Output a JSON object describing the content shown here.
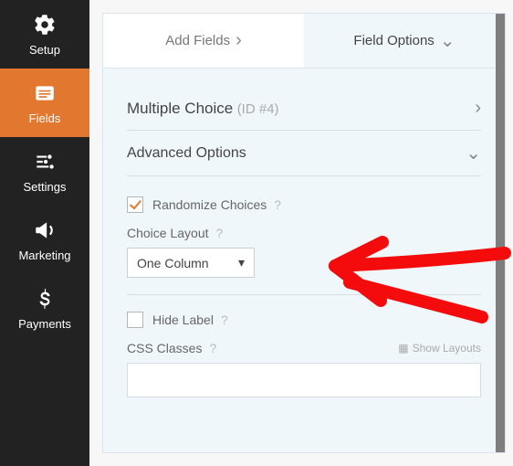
{
  "sidebar": {
    "items": [
      {
        "label": "Setup",
        "icon": "gear-icon"
      },
      {
        "label": "Fields",
        "icon": "form-icon"
      },
      {
        "label": "Settings",
        "icon": "sliders-icon"
      },
      {
        "label": "Marketing",
        "icon": "bullhorn-icon"
      },
      {
        "label": "Payments",
        "icon": "dollar-icon"
      }
    ],
    "active_index": 1
  },
  "tabs": {
    "add_fields": "Add Fields",
    "field_options": "Field Options"
  },
  "section": {
    "multiple_choice": "Multiple Choice",
    "id_prefix": "(ID #",
    "field_id": "4",
    "id_suffix": ")",
    "advanced_options": "Advanced Options"
  },
  "options": {
    "randomize_choices": {
      "label": "Randomize Choices",
      "checked": true
    },
    "choice_layout": {
      "label": "Choice Layout",
      "selected": "One Column"
    },
    "hide_label": {
      "label": "Hide Label",
      "checked": false
    },
    "css_classes": {
      "label": "CSS Classes",
      "value": ""
    },
    "show_layouts": "Show Layouts"
  },
  "colors": {
    "accent": "#e27730",
    "sidebar_bg": "#222222",
    "panel_bg": "#f0f7fb",
    "arrow": "#f40c0c"
  }
}
